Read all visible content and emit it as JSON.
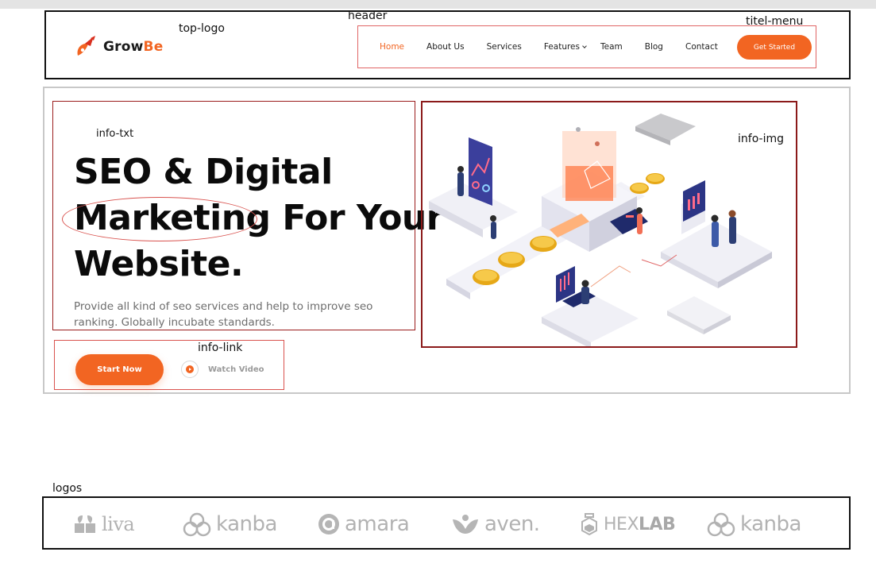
{
  "annotations": {
    "header": "header",
    "top_logo": "top-logo",
    "title_menu": "titel-menu",
    "info_txt": "info-txt",
    "info_img": "info-img",
    "info_link": "info-link",
    "logos": "logos"
  },
  "brand": {
    "name_part1": "Grow",
    "name_part2": "Be",
    "accent_color": "#f26522"
  },
  "nav": {
    "items": [
      {
        "label": "Home",
        "active": true
      },
      {
        "label": "About Us",
        "active": false
      },
      {
        "label": "Services",
        "active": false
      },
      {
        "label": "Features",
        "active": false,
        "has_dropdown": true
      },
      {
        "label": "Team",
        "active": false
      },
      {
        "label": "Blog",
        "active": false
      },
      {
        "label": "Contact",
        "active": false
      }
    ],
    "cta_label": "Get Started"
  },
  "hero": {
    "headline_line1": "SEO & Digital",
    "headline_line2": "Marketing For Your",
    "headline_line3": "Website.",
    "description": "Provide all kind of seo services and help to improve seo ranking. Globally incubate standards.",
    "primary_button": "Start Now",
    "secondary_link": "Watch Video"
  },
  "partner_logos": [
    {
      "name": "liva",
      "icon": "liva-logo-icon"
    },
    {
      "name": "kanba",
      "icon": "kanba-logo-icon"
    },
    {
      "name": "amara",
      "icon": "amara-logo-icon"
    },
    {
      "name": "aven.",
      "icon": "aven-logo-icon"
    },
    {
      "name_part1": "HEX",
      "name_part2": "LAB",
      "icon": "hexlab-logo-icon"
    },
    {
      "name": "kanba",
      "icon": "kanba-logo-icon"
    }
  ]
}
